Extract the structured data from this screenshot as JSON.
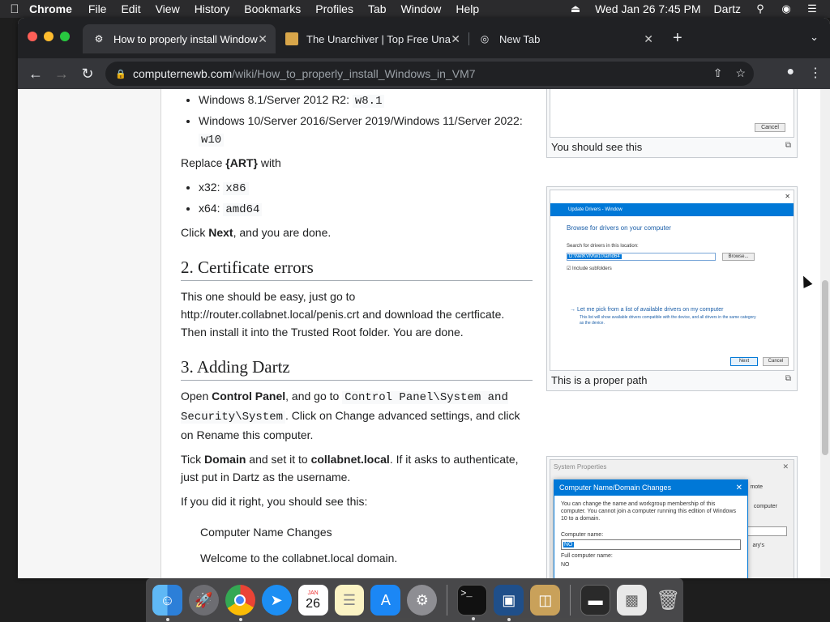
{
  "menubar": {
    "app": "Chrome",
    "items": [
      "File",
      "Edit",
      "View",
      "History",
      "Bookmarks",
      "Profiles",
      "Tab",
      "Window",
      "Help"
    ],
    "clock": "Wed Jan 26  7:45 PM",
    "user": "Dartz"
  },
  "tabs": [
    {
      "title": "How to properly install Window",
      "icon": "wiki-favicon",
      "active": true
    },
    {
      "title": "The Unarchiver | Top Free Una",
      "icon": "unarchiver-favicon",
      "active": false
    },
    {
      "title": "New Tab",
      "icon": "chrome-favicon",
      "active": false
    }
  ],
  "address": {
    "domain": "computernewb.com",
    "path": "/wiki/How_to_properly_install_Windows_in_VM7"
  },
  "article": {
    "bullets_top": [
      {
        "prefix": "Windows 8.1/Server 2012 R2: ",
        "code": "w8.1"
      },
      {
        "prefix": "Windows 10/Server 2016/Server 2019/Windows 11/Server 2022: ",
        "code": "w10"
      }
    ],
    "replace_text": "Replace ",
    "replace_bold": "{ART}",
    "replace_suffix": " with",
    "bullets_arch": [
      {
        "prefix": "x32: ",
        "code": "x86"
      },
      {
        "prefix": "x64: ",
        "code": "amd64"
      }
    ],
    "click_prefix": "Click ",
    "click_bold": "Next",
    "click_suffix": ", and you are done.",
    "h_cert": "2. Certificate errors",
    "cert_text": "This one should be easy, just go to http://router.collabnet.local/penis.crt and download the certficate. Then install it into the Trusted Root folder. You are done.",
    "h_dartz": "3. Adding Dartz",
    "open_prefix": "Open ",
    "open_bold": "Control Panel",
    "open_mid": ", and go to ",
    "open_code": "Control Panel\\System and Security\\System",
    "open_suffix": ". Click on Change advanced settings, and click on Rename this computer.",
    "tick_prefix": "Tick ",
    "tick_bold1": "Domain",
    "tick_mid": " and set it to ",
    "tick_bold2": "collabnet.local",
    "tick_suffix": ". If it asks to authenticate, just put in Dartz as the username.",
    "if_right": "If you did it right, you should see this:",
    "quote_title": "Computer Name Changes",
    "quote_body": "Welcome to the collabnet.local domain."
  },
  "thumbs": [
    {
      "caption": "You should see this",
      "button": "Cancel"
    },
    {
      "caption": "This is a proper path",
      "dialog_title": "Update Drivers - Window",
      "heading": "Browse for drivers on your computer",
      "search_label": "Search for drivers in this location:",
      "path": "D:\\NetKVM\\w10\\amd64",
      "browse": "Browse...",
      "include": "Include subfolders",
      "pick": "→ Let me pick from a list of available drivers on my computer",
      "pick_sub": "This list will show available drivers compatible with the device, and all drivers in the same category as the device.",
      "next": "Next",
      "cancel": "Cancel"
    },
    {
      "bg_title": "System Properties",
      "bg_tab": "mote",
      "bg_side1": "computer",
      "bg_side2": "ary's",
      "dialog_title": "Computer Name/Domain Changes",
      "desc": "You can change the name and workgroup membership of this computer. You cannot join a computer running this edition of Windows 10 to a domain.",
      "name_label": "Computer name:",
      "name_value": "NO",
      "full_label": "Full computer name:",
      "full_value": "NO"
    }
  ],
  "dock": [
    "finder",
    "launchpad",
    "chrome",
    "safari",
    "calendar",
    "notes",
    "app-store",
    "system-preferences",
    "terminal",
    "virtualbox",
    "archive-utility",
    "screenshot-1",
    "screenshot-2",
    "trash"
  ],
  "calendar": {
    "month": "JAN",
    "day": "26"
  },
  "colors": {
    "accent": "#0078d7",
    "link": "#0645ad"
  }
}
